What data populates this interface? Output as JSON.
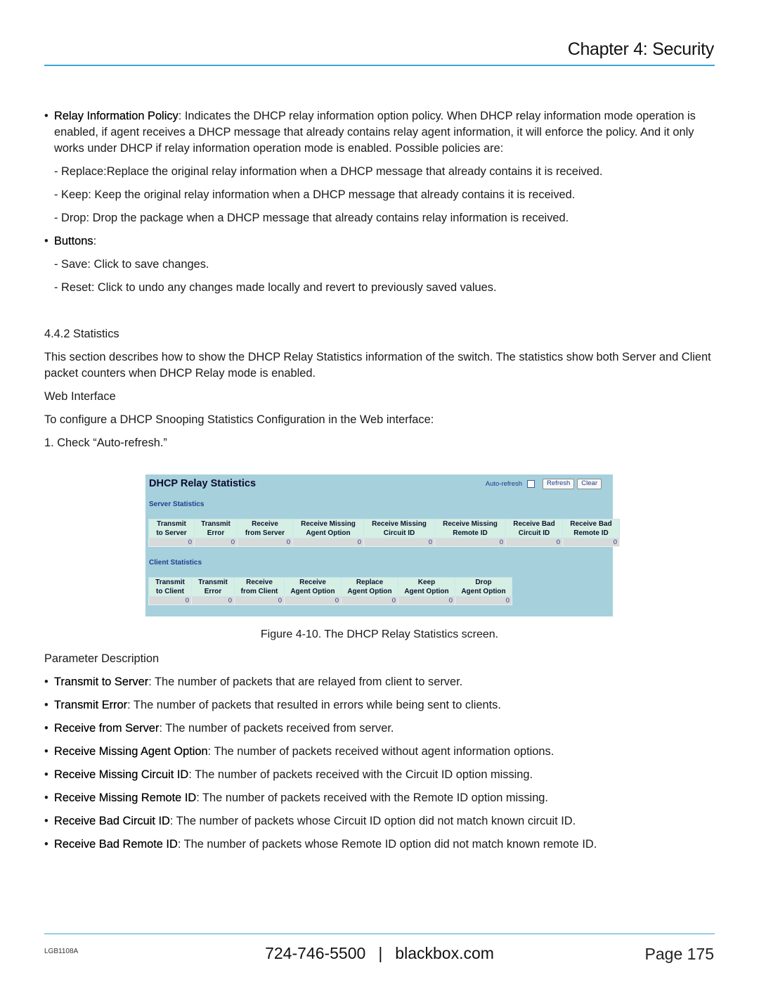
{
  "header": {
    "chapter_title": "Chapter 4: Security"
  },
  "relay_policy": {
    "term": "Relay Information Policy",
    "text": ": Indicates the DHCP relay information option policy. When DHCP relay information mode operation is enabled, if agent receives a DHCP message that already contains relay agent information, it will enforce the policy. And it only works under DHCP if relay information operation mode is enabled. Possible policies are:",
    "options": [
      "- Replace:Replace the original relay information when a DHCP message that already contains it is received.",
      "- Keep: Keep the original relay information when a DHCP message that already contains it is received.",
      "- Drop: Drop the package when a DHCP message that already contains relay information is received."
    ]
  },
  "buttons_section": {
    "term": "Buttons",
    "suffix": ":",
    "items": [
      "- Save: Click to save changes.",
      "- Reset: Click to undo any changes made locally and revert to previously saved values."
    ]
  },
  "statistics_section": {
    "heading": "4.4.2 Statistics",
    "intro": "This section describes how to show the DHCP Relay Statistics information of the switch. The statistics show both Server and Client packet counters when DHCP Relay mode is enabled.",
    "web_interface_heading": "Web Interface",
    "web_interface_text": "To configure a DHCP Snooping Statistics Configuration in the Web interface:",
    "step1": "1. Check “Auto-refresh.”"
  },
  "web_ui": {
    "title": "DHCP Relay Statistics",
    "auto_refresh_label": "Auto-refresh",
    "auto_refresh_checked": false,
    "refresh_button": "Refresh",
    "clear_button": "Clear",
    "server": {
      "title": "Server Statistics",
      "headers": [
        [
          "Transmit",
          "to Server"
        ],
        [
          "Transmit",
          "Error"
        ],
        [
          "Receive",
          "from Server"
        ],
        [
          "Receive Missing",
          "Agent Option"
        ],
        [
          "Receive Missing",
          "Circuit ID"
        ],
        [
          "Receive Missing",
          "Remote ID"
        ],
        [
          "Receive Bad",
          "Circuit ID"
        ],
        [
          "Receive Bad",
          "Remote ID"
        ]
      ],
      "values": [
        "0",
        "0",
        "0",
        "0",
        "0",
        "0",
        "0",
        "0"
      ]
    },
    "client": {
      "title": "Client Statistics",
      "headers": [
        [
          "Transmit",
          "to Client"
        ],
        [
          "Transmit",
          "Error"
        ],
        [
          "Receive",
          "from Client"
        ],
        [
          "Receive",
          "Agent Option"
        ],
        [
          "Replace",
          "Agent Option"
        ],
        [
          "Keep",
          "Agent Option"
        ],
        [
          "Drop",
          "Agent Option"
        ]
      ],
      "values": [
        "0",
        "0",
        "0",
        "0",
        "0",
        "0",
        "0"
      ]
    }
  },
  "figure_caption": "Figure 4-10. The DHCP Relay Statistics screen.",
  "parameters": {
    "heading": "Parameter Description",
    "items": [
      {
        "term": "Transmit to Server",
        "text": ": The number of packets that are relayed from client to server."
      },
      {
        "term": "Transmit Error",
        "text": ": The number of packets that resulted in errors while being sent to clients."
      },
      {
        "term": "Receive from Server",
        "text": ": The number of packets received from server."
      },
      {
        "term": "Receive Missing Agent Option",
        "text": ": The number of packets received without agent information options."
      },
      {
        "term": "Receive Missing Circuit ID",
        "text": ": The number of packets received with the Circuit ID option missing."
      },
      {
        "term": "Receive Missing Remote ID",
        "text": ": The number of packets received with the Remote ID option missing."
      },
      {
        "term": "Receive Bad Circuit ID",
        "text": ": The number of packets whose Circuit ID option did not match known circuit ID."
      },
      {
        "term": "Receive Bad Remote ID",
        "text": ": The number of packets whose Remote ID option did not match known remote ID."
      }
    ]
  },
  "footer": {
    "doc_code": "LGB1108A",
    "phone": "724-746-5500",
    "separator": "|",
    "website": "blackbox.com",
    "page": "Page 175"
  },
  "colors": {
    "accent_rule": "#3ca3d4",
    "panel_bg": "#a6d0dc",
    "table_header_bg": "#d5efe4",
    "table_cell_bg": "#d7dad9",
    "section_title": "#1f3f8c"
  }
}
